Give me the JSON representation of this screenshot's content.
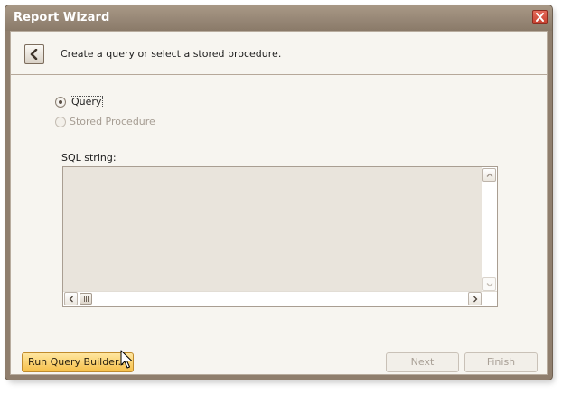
{
  "window": {
    "title": "Report Wizard"
  },
  "header": {
    "back_icon": "chevron-left-icon",
    "description": "Create a query or select a stored procedure."
  },
  "source_options": [
    {
      "label": "Query",
      "selected": true,
      "enabled": true
    },
    {
      "label": "Stored Procedure",
      "selected": false,
      "enabled": false
    }
  ],
  "sql": {
    "label": "SQL string:",
    "value": ""
  },
  "buttons": {
    "run_query_builder": "Run Query Builder...",
    "next": "Next",
    "finish": "Finish"
  },
  "colors": {
    "title_bar": "#8f7e6d",
    "client_bg": "#f7f5f0",
    "accent_button": "#f6c04a",
    "close_button": "#c7402f"
  }
}
